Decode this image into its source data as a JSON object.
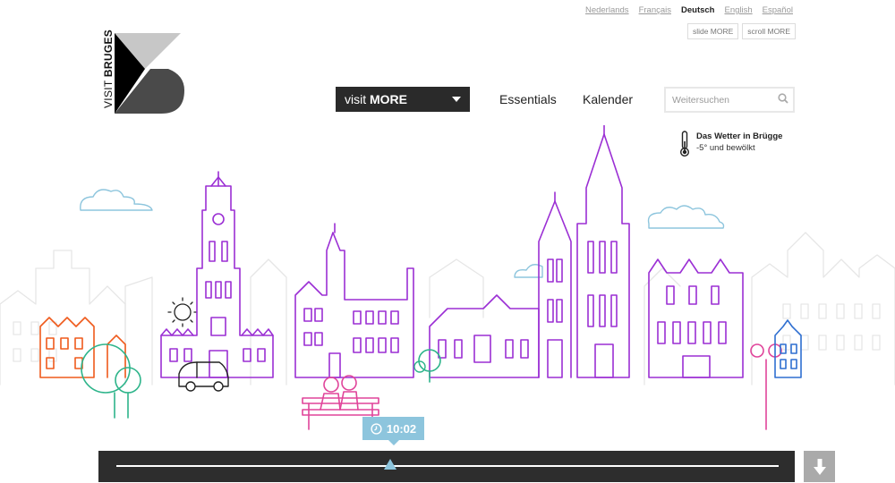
{
  "languages": [
    {
      "label": "Nederlands",
      "active": false
    },
    {
      "label": "Français",
      "active": false
    },
    {
      "label": "Deutsch",
      "active": true
    },
    {
      "label": "English",
      "active": false
    },
    {
      "label": "Español",
      "active": false
    }
  ],
  "mode_switch": {
    "slide": "slide MORE",
    "scroll": "scroll MORE"
  },
  "logo": {
    "text_light": "VISIT ",
    "text_bold": "BRUGES"
  },
  "nav": {
    "visit_more_prefix": "visit ",
    "visit_more_bold": "MORE",
    "essentials": "Essentials",
    "kalender": "Kalender"
  },
  "search": {
    "placeholder": "Weitersuchen"
  },
  "weather": {
    "title": "Das Wetter in Brügge",
    "description": "-5° und bewölkt"
  },
  "timeline": {
    "time": "10:02"
  },
  "colors": {
    "purple": "#9b2fd4",
    "magenta": "#e0449a",
    "orange": "#ef5a1c",
    "teal": "#2db48a",
    "blue": "#2f6fd1",
    "sky": "#8dc5dd",
    "dark": "#2d2d2d",
    "ghost": "#e6e6e6"
  },
  "icons": [
    "search-icon",
    "thermometer-icon",
    "clock-icon",
    "caret-down-icon",
    "arrow-down-icon",
    "sun-icon"
  ]
}
